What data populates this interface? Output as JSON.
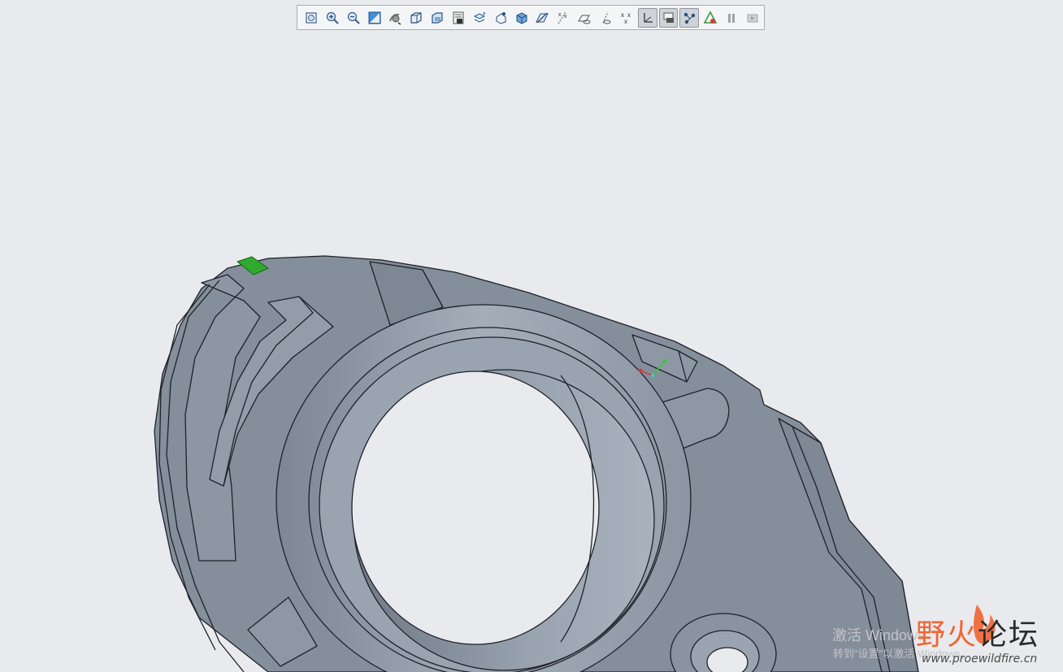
{
  "toolbar": {
    "buttons": [
      {
        "name": "refit-icon",
        "active": false
      },
      {
        "name": "zoom-in-icon",
        "active": false
      },
      {
        "name": "zoom-out-icon",
        "active": false
      },
      {
        "name": "repaint-icon",
        "active": false
      },
      {
        "name": "spin-center-icon",
        "active": false
      },
      {
        "name": "saved-orientations-icon",
        "active": false
      },
      {
        "name": "view-manager-icon",
        "active": false
      },
      {
        "name": "display-style-icon",
        "active": false
      },
      {
        "name": "layers-icon",
        "active": false
      },
      {
        "name": "appearance-icon",
        "active": false
      },
      {
        "name": "section-icon",
        "active": false
      },
      {
        "name": "datum-planes-icon",
        "active": false
      },
      {
        "name": "datum-axes-icon",
        "active": false
      },
      {
        "name": "datum-plane-display-icon",
        "active": false
      },
      {
        "name": "datum-axis-display-icon",
        "active": false
      },
      {
        "name": "datum-point-display-icon",
        "active": false
      },
      {
        "name": "csys-display-icon",
        "active": true
      },
      {
        "name": "annotation-display-icon",
        "active": true
      },
      {
        "name": "spin-center-display-icon",
        "active": true
      },
      {
        "name": "simulation-icon",
        "active": false
      },
      {
        "name": "pause-icon",
        "active": false
      },
      {
        "name": "next-icon",
        "active": false
      }
    ]
  },
  "model": {
    "body_color": "#8a94a0",
    "edge_color": "#1e2228"
  },
  "watermark": {
    "activate": "激活 Windows",
    "activate_sub": "转到\"设置\"以激活 Windows。"
  },
  "forum": {
    "name_fire": "野火",
    "name_rest": "论坛",
    "url": "www.proewildfire.cn"
  }
}
